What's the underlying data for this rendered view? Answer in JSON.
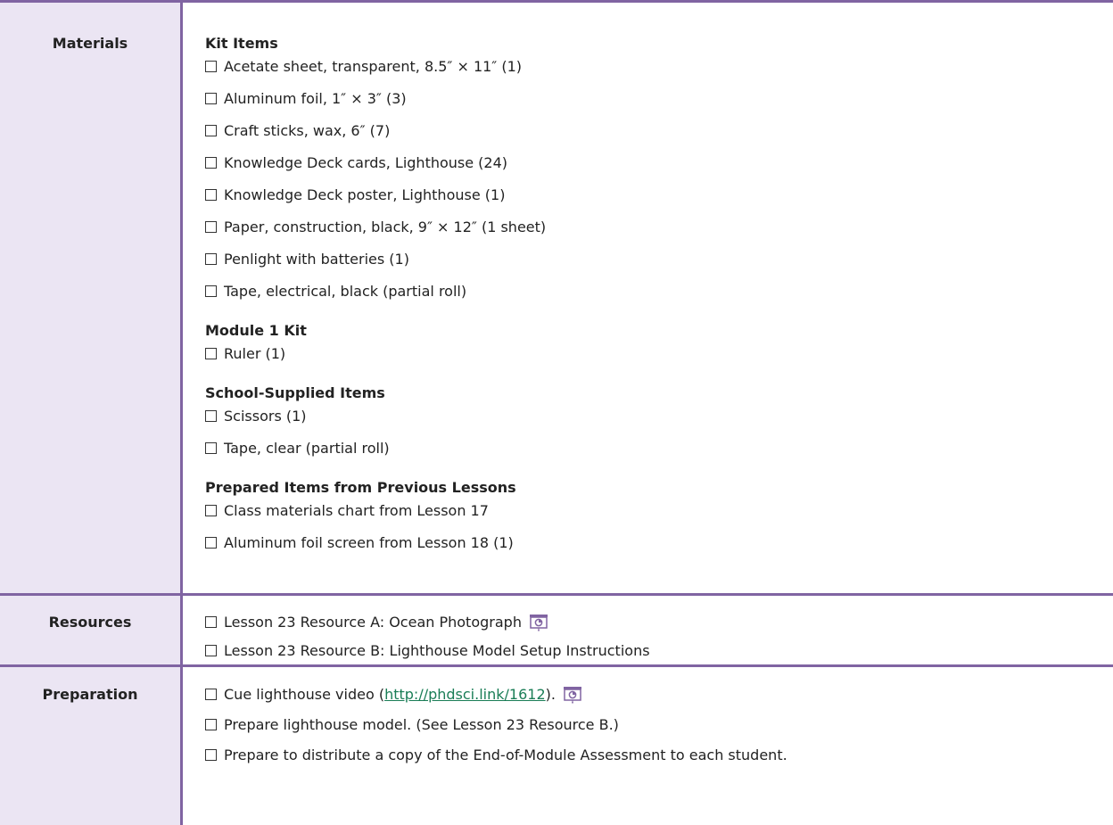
{
  "colors": {
    "accent": "#8064a2",
    "label_bg": "#ebe5f3",
    "link": "#1a7d56"
  },
  "materials": {
    "label": "Materials",
    "groups": [
      {
        "heading": "Kit Items",
        "items": [
          "Acetate sheet, transparent, 8.5″ × 11″ (1)",
          "Aluminum foil, 1″ × 3″ (3)",
          "Craft sticks, wax, 6″ (7)",
          "Knowledge Deck cards, Lighthouse (24)",
          "Knowledge Deck poster, Lighthouse (1)",
          "Paper, construction, black, 9″ × 12″ (1 sheet)",
          "Penlight with batteries (1)",
          "Tape, electrical, black (partial roll)"
        ]
      },
      {
        "heading": "Module 1 Kit",
        "items": [
          "Ruler (1)"
        ]
      },
      {
        "heading": "School-Supplied Items",
        "items": [
          "Scissors (1)",
          "Tape, clear (partial roll)"
        ]
      },
      {
        "heading": "Prepared Items from Previous Lessons",
        "items": [
          "Class materials chart from Lesson 17",
          "Aluminum foil screen from Lesson 18 (1)"
        ]
      }
    ]
  },
  "resources": {
    "label": "Resources",
    "items": [
      {
        "text": "Lesson 23 Resource A: Ocean Photograph",
        "icon": "projector-icon"
      },
      {
        "text": "Lesson 23 Resource B: Lighthouse Model Setup Instructions"
      }
    ]
  },
  "preparation": {
    "label": "Preparation",
    "items": [
      {
        "prefix": "Cue lighthouse video (",
        "link": "http://phdsci.link/1612",
        "suffix": ").",
        "icon": "projector-icon"
      },
      {
        "text": "Prepare lighthouse model. (See Lesson 23 Resource B.)"
      },
      {
        "text": "Prepare to distribute a copy of the End-of-Module Assessment to each student."
      }
    ]
  }
}
